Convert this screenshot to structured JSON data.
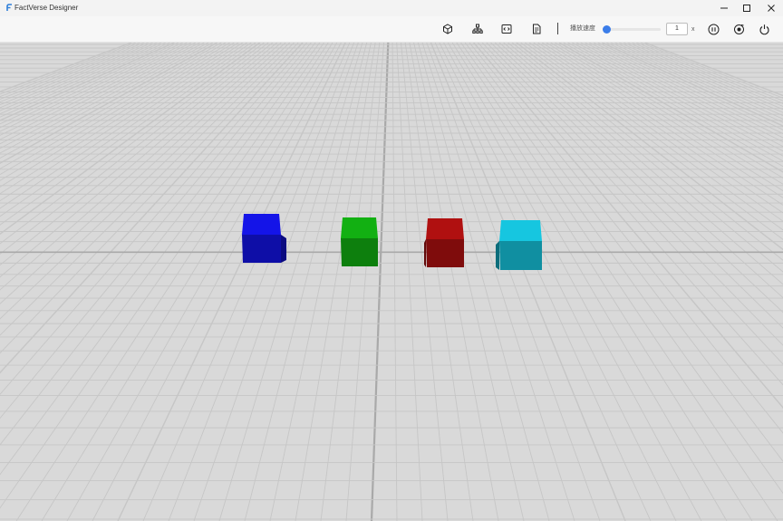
{
  "window": {
    "title": "FactVerse Designer",
    "controls": [
      "minimize-icon",
      "maximize-icon",
      "close-icon"
    ]
  },
  "toolbar": {
    "icons": [
      "cube-icon",
      "hierarchy-icon",
      "code-icon",
      "document-icon"
    ],
    "speed_label": "播放速度",
    "speed_value": "1",
    "speed_unit": "x",
    "speed_slider_fraction": 0.0,
    "right_icons": [
      "pause-icon",
      "record-icon",
      "power-icon"
    ]
  },
  "scene": {
    "ground_color": "#d9d9d9",
    "grid_color": "#c6c6c6",
    "cubes": [
      {
        "name": "blue-cube",
        "color": "#1414e8"
      },
      {
        "name": "green-cube",
        "color": "#12b012"
      },
      {
        "name": "red-cube",
        "color": "#b01010"
      },
      {
        "name": "cyan-cube",
        "color": "#16c6e0"
      }
    ]
  }
}
